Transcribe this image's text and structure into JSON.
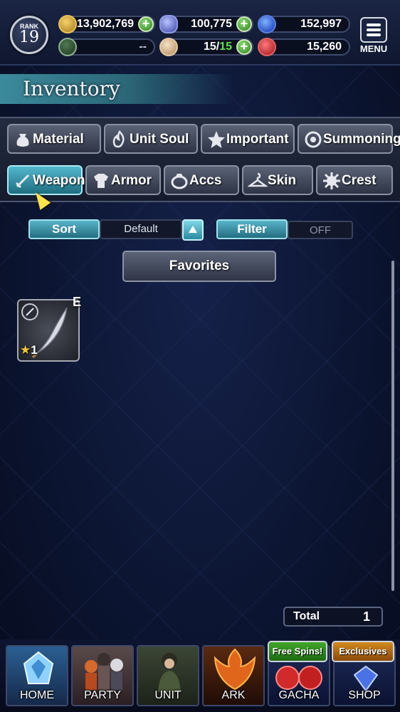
{
  "header": {
    "rank_label": "RANK",
    "rank_value": "19",
    "gold": "13,902,769",
    "crystals": "100,775",
    "blue_orbs": "152,997",
    "mark_value": "--",
    "stamina_current": "15",
    "stamina_separator": "/",
    "stamina_max": "15",
    "red_orbs": "15,260",
    "menu_label": "MENU"
  },
  "title": "Inventory",
  "tabs_row1": [
    {
      "label": "Material",
      "icon": "sack-icon"
    },
    {
      "label": "Unit Soul",
      "icon": "flame-icon"
    },
    {
      "label": "Important",
      "icon": "star-icon"
    },
    {
      "label": "Summoning",
      "icon": "summon-stone-icon"
    }
  ],
  "tabs_row2": [
    {
      "label": "Weapon",
      "icon": "sword-icon",
      "active": true
    },
    {
      "label": "Armor",
      "icon": "armor-icon"
    },
    {
      "label": "Accs",
      "icon": "ring-icon"
    },
    {
      "label": "Skin",
      "icon": "hanger-icon"
    },
    {
      "label": "Crest",
      "icon": "crest-icon"
    }
  ],
  "sort": {
    "label": "Sort",
    "value": "Default"
  },
  "filter": {
    "label": "Filter",
    "value": "OFF"
  },
  "favorites_label": "Favorites",
  "items": [
    {
      "grade": "E",
      "rarity_star": "★",
      "rarity_value": "1",
      "type": "dagger"
    }
  ],
  "total": {
    "label": "Total",
    "value": "1"
  },
  "nav": [
    {
      "label": "HOME"
    },
    {
      "label": "PARTY"
    },
    {
      "label": "UNIT"
    },
    {
      "label": "ARK"
    },
    {
      "label": "GACHA",
      "badge": "Free Spins!"
    },
    {
      "label": "SHOP",
      "badge": "Exclusives"
    }
  ],
  "colors": {
    "accent": "#3fa7bd",
    "stamina_max": "#5ee34a",
    "free_badge": "#2e8a1d",
    "exclusive_badge": "#c07a16"
  }
}
